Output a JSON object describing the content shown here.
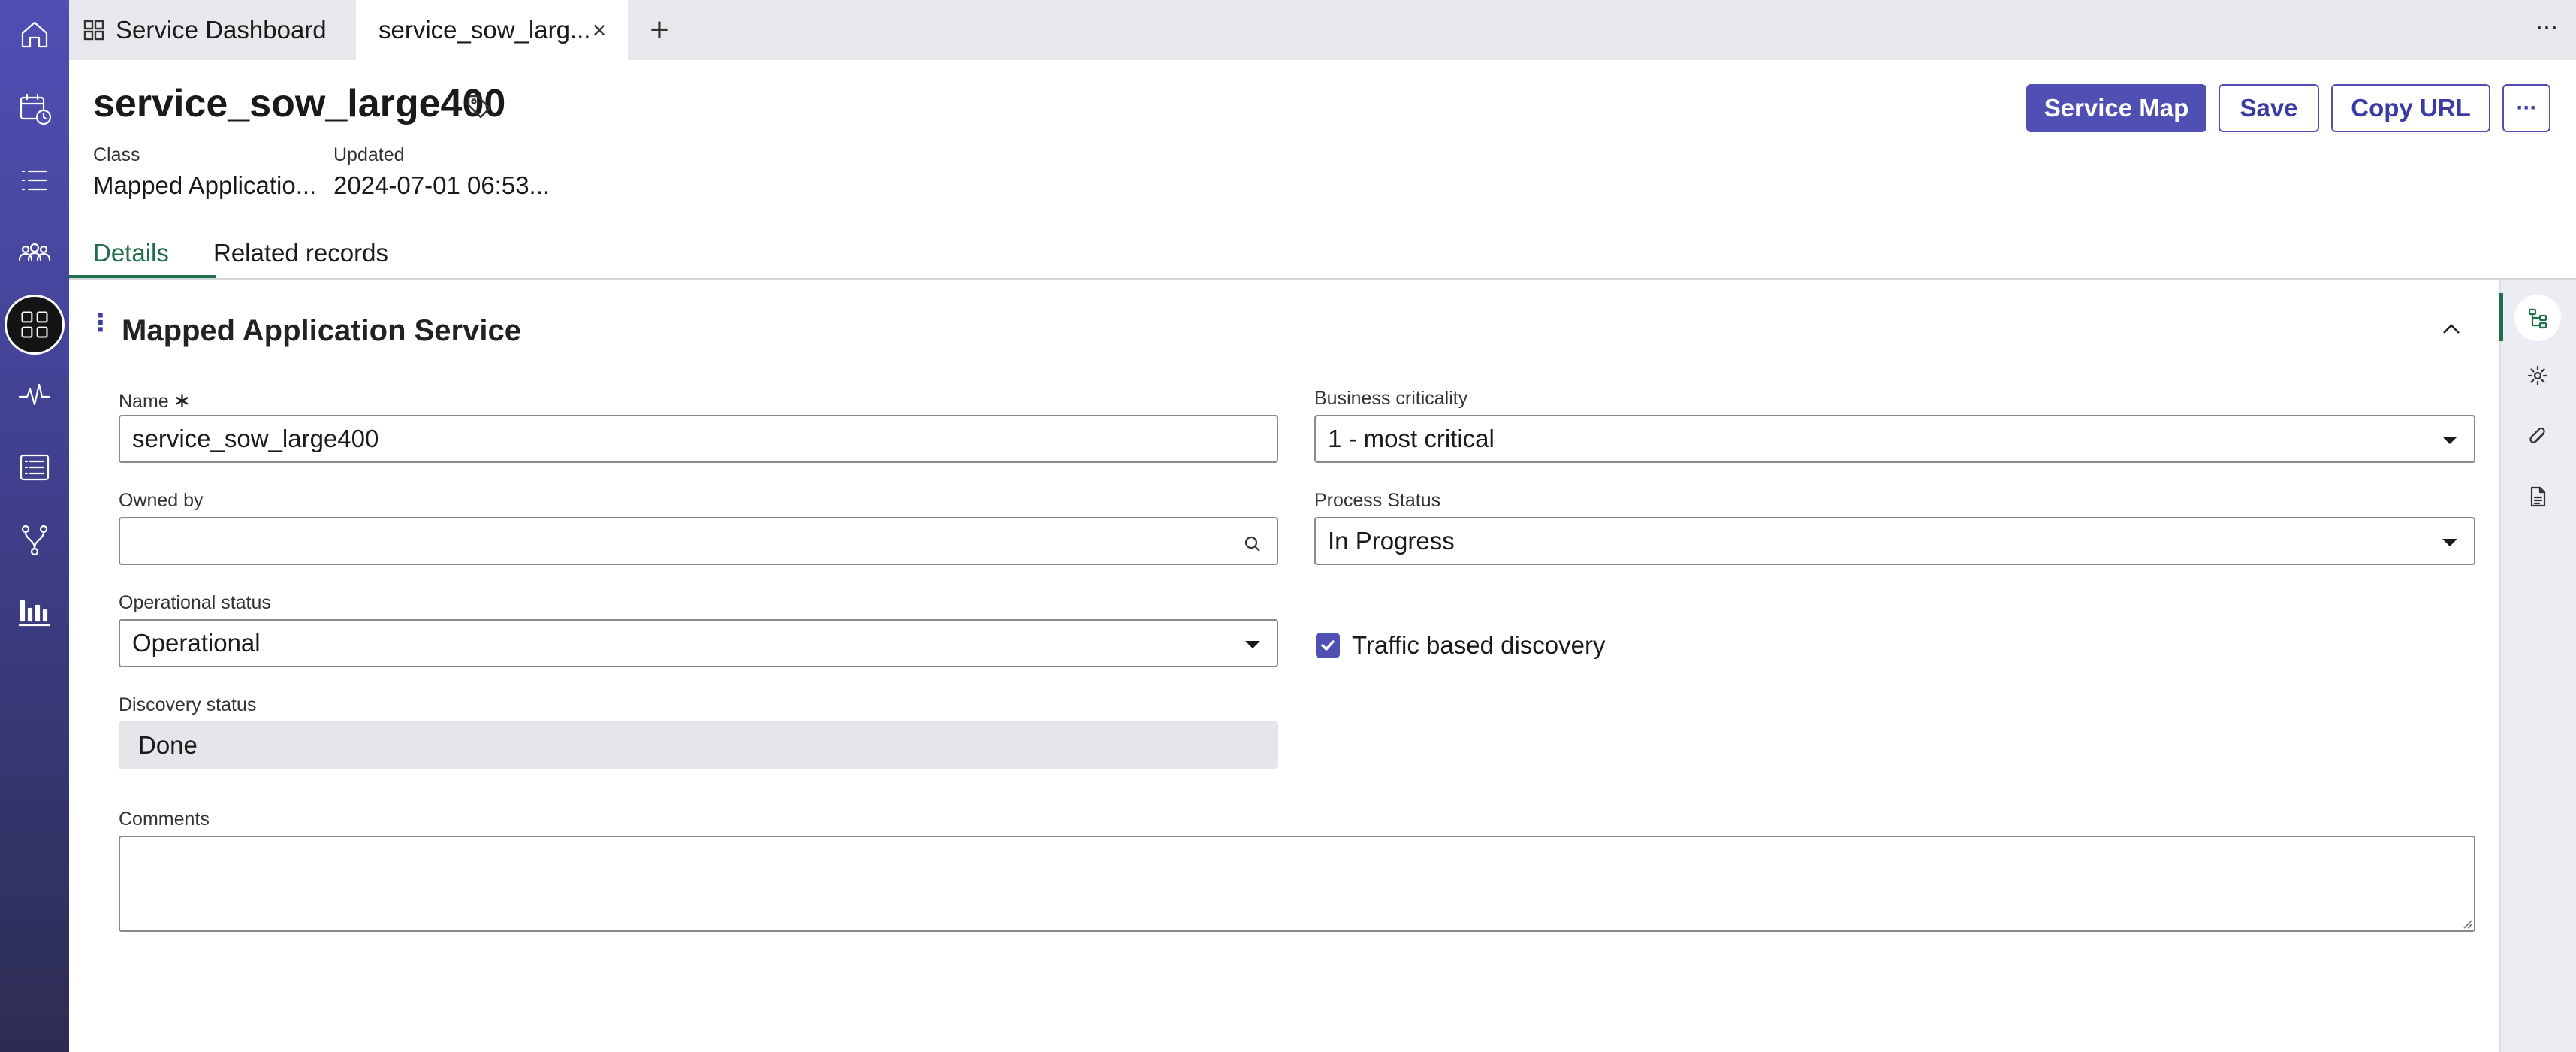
{
  "browser_tabs": {
    "dashboard_label": "Service Dashboard",
    "active_label": "service_sow_larg...",
    "close_glyph": "×",
    "add_glyph": "+",
    "more_glyph": "···"
  },
  "nav_rail": {
    "icons": [
      "home-icon",
      "calendar-clock-icon",
      "list-icon",
      "people-group-icon",
      "apps-grid-icon",
      "pulse-icon",
      "form-list-icon",
      "branch-icon",
      "bar-chart-icon"
    ],
    "active_icon": "apps-grid-icon"
  },
  "record": {
    "title": "service_sow_large400",
    "class_label": "Class",
    "class_value": "Mapped Applicatio...",
    "updated_label": "Updated",
    "updated_value": "2024-07-01 06:53..."
  },
  "header_buttons": {
    "service_map": "Service Map",
    "save": "Save",
    "copy_url": "Copy URL",
    "more": "···"
  },
  "record_tabs": {
    "details": "Details",
    "related": "Related records"
  },
  "section": {
    "title": "Mapped Application Service"
  },
  "form": {
    "name_label": "Name",
    "required_glyph": "∗",
    "name_value": "service_sow_large400",
    "owned_by_label": "Owned by",
    "owned_by_value": "",
    "operational_status_label": "Operational status",
    "operational_status_value": "Operational",
    "discovery_status_label": "Discovery status",
    "discovery_status_value": "Done",
    "business_criticality_label": "Business criticality",
    "business_criticality_value": "1 - most critical",
    "process_status_label": "Process Status",
    "process_status_value": "In Progress",
    "traffic_discovery_label": "Traffic based discovery",
    "traffic_discovery_checked": true,
    "comments_label": "Comments",
    "comments_value": ""
  },
  "colors": {
    "accent": "#4f4fb4",
    "active_tab_green": "#1f6f4a",
    "rail_top": "#4f4fb4",
    "rail_bottom": "#2c2c52"
  }
}
